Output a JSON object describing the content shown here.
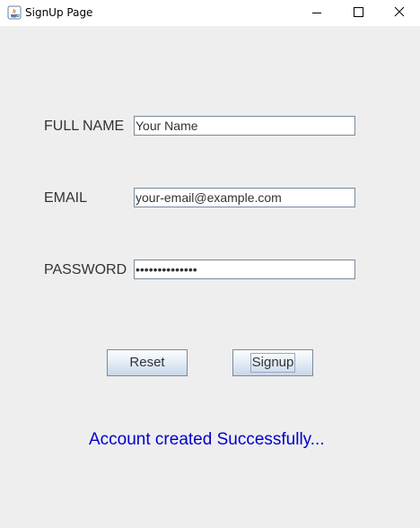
{
  "window": {
    "title": "SignUp Page"
  },
  "form": {
    "full_name_label": "FULL NAME",
    "full_name_value": "Your Name",
    "email_label": "EMAIL",
    "email_value": "your-email@example.com",
    "password_label": "PASSWORD",
    "password_value": "••••••••••••••"
  },
  "buttons": {
    "reset_label": "Reset",
    "signup_label": "Signup"
  },
  "status": {
    "message": "Account created Successfully..."
  },
  "colors": {
    "status_text": "#0000cc",
    "window_background": "#eeeeee"
  }
}
